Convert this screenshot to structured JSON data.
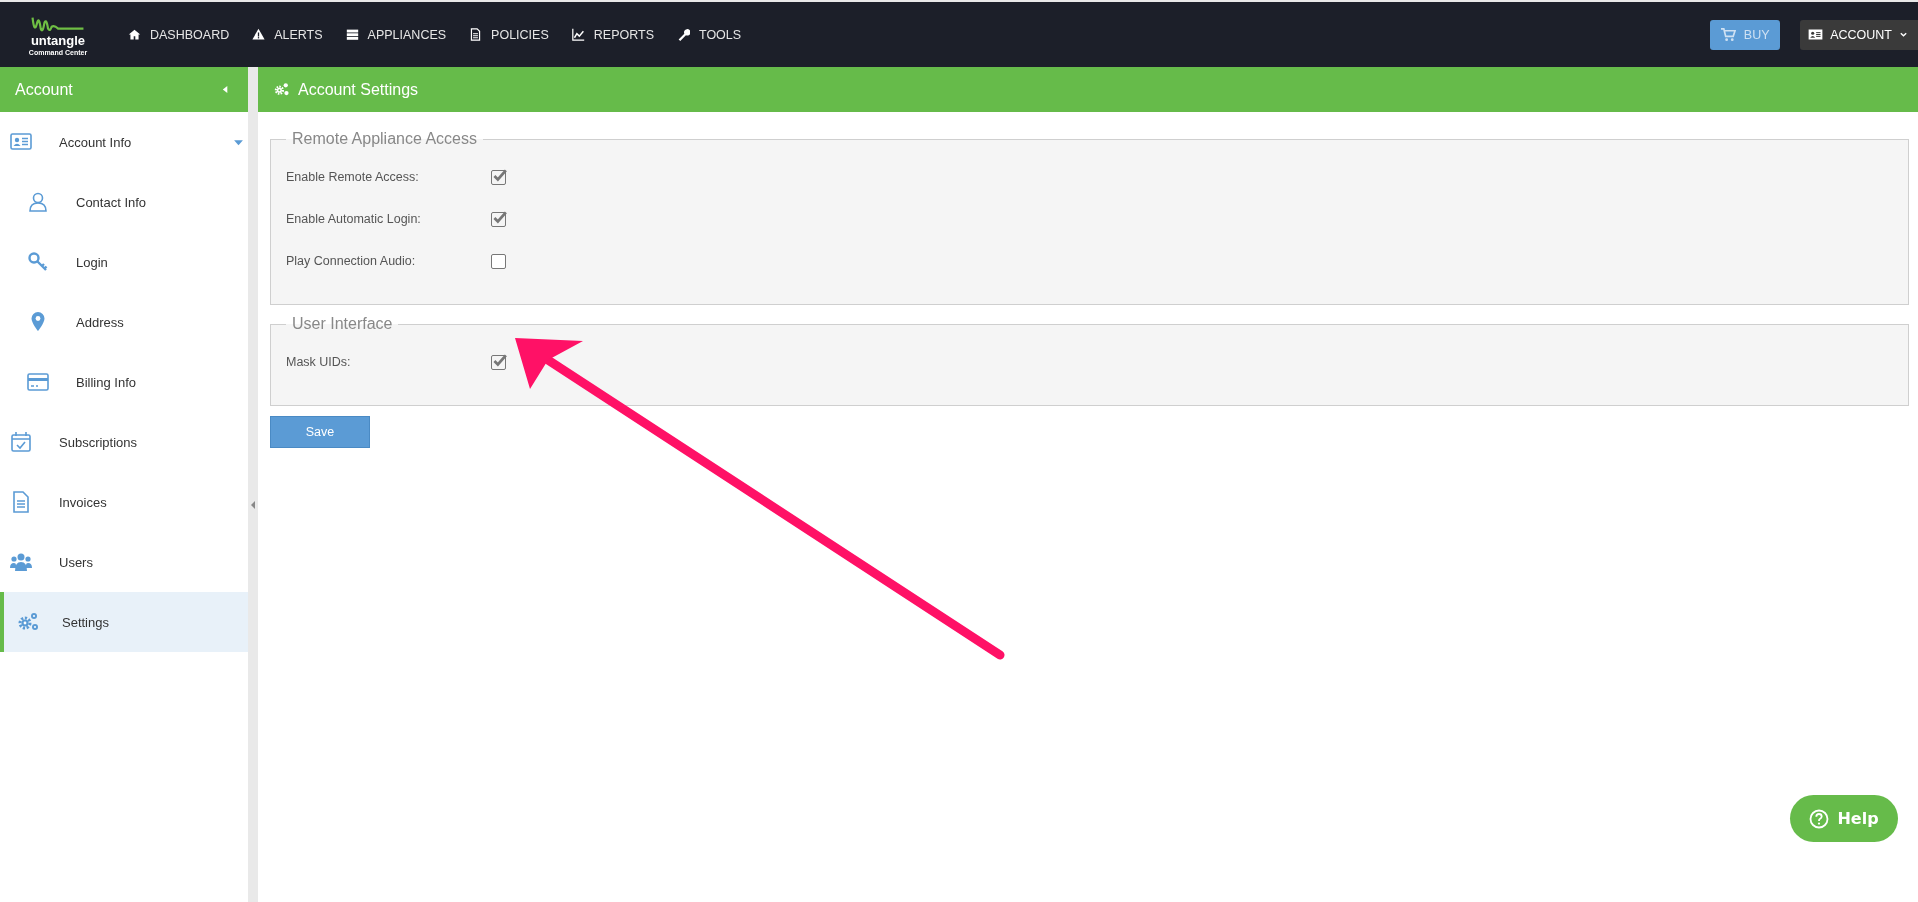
{
  "logo": {
    "name": "untangle",
    "subtitle": "Command Center"
  },
  "nav": [
    {
      "label": "DASHBOARD"
    },
    {
      "label": "ALERTS"
    },
    {
      "label": "APPLIANCES"
    },
    {
      "label": "POLICIES"
    },
    {
      "label": "REPORTS"
    },
    {
      "label": "TOOLS"
    }
  ],
  "buy_button": "BUY",
  "account_menu": "ACCOUNT",
  "sidebar": {
    "title": "Account",
    "items": [
      {
        "label": "Account Info",
        "selected": false,
        "expanded": true,
        "children": [
          {
            "label": "Contact Info",
            "selected": false
          },
          {
            "label": "Login",
            "selected": false
          },
          {
            "label": "Address",
            "selected": false
          },
          {
            "label": "Billing Info",
            "selected": false
          }
        ]
      },
      {
        "label": "Subscriptions",
        "selected": false
      },
      {
        "label": "Invoices",
        "selected": false
      },
      {
        "label": "Users",
        "selected": false
      },
      {
        "label": "Settings",
        "selected": true
      }
    ]
  },
  "page_title": "Account Settings",
  "fieldsets": [
    {
      "legend": "Remote Appliance Access",
      "rows": [
        {
          "label": "Enable Remote Access:",
          "checked": true
        },
        {
          "label": "Enable Automatic Login:",
          "checked": true
        },
        {
          "label": "Play Connection Audio:",
          "checked": false
        }
      ]
    },
    {
      "legend": "User Interface",
      "rows": [
        {
          "label": "Mask UIDs:",
          "checked": true
        }
      ]
    }
  ],
  "save_button": "Save",
  "help_button": "Help"
}
